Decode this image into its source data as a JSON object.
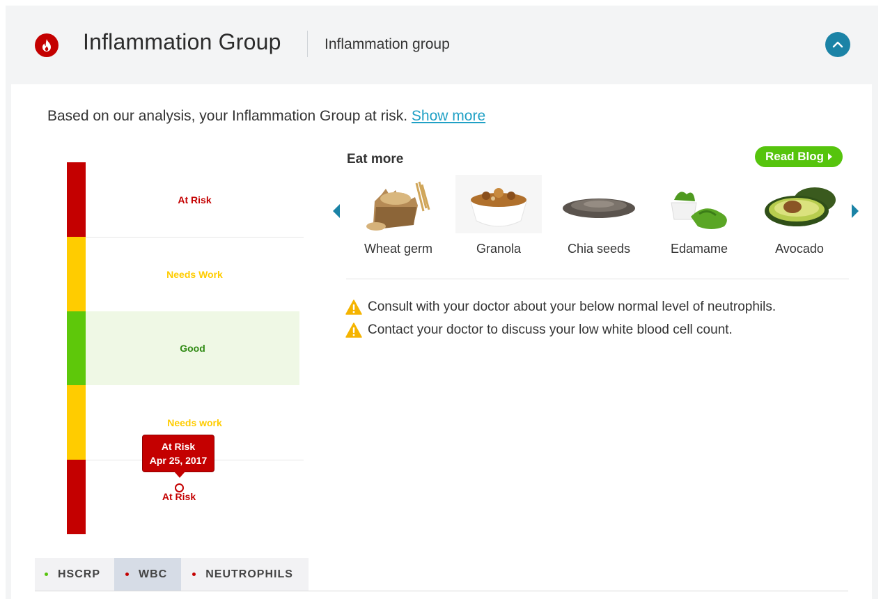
{
  "header": {
    "title": "Inflammation Group",
    "subtitle": "Inflammation group",
    "icon": "flame-icon",
    "accent": "#c40000",
    "collapse_icon": "chevron-up-icon"
  },
  "summary": {
    "text": "Based on our analysis, your Inflammation Group at risk. ",
    "link": "Show more"
  },
  "gauge": {
    "zones": [
      {
        "label": "At Risk",
        "color": "#c40000"
      },
      {
        "label": "Needs Work",
        "color": "#ffcc00"
      },
      {
        "label": "Good",
        "color": "#2f8a13"
      },
      {
        "label": "Needs work",
        "color": "#ffcc00"
      },
      {
        "label": "At Risk",
        "color": "#c40000"
      }
    ],
    "tooltip": {
      "status": "At Risk",
      "date": "Apr 25, 2017"
    },
    "current": "At Risk"
  },
  "eat_more": {
    "title": "Eat more",
    "read_blog": "Read Blog",
    "foods": [
      {
        "name": "Wheat germ",
        "icon": "wheat-germ-image"
      },
      {
        "name": "Granola",
        "icon": "granola-image"
      },
      {
        "name": "Chia seeds",
        "icon": "chia-seeds-image"
      },
      {
        "name": "Edamame",
        "icon": "edamame-image"
      },
      {
        "name": "Avocado",
        "icon": "avocado-image"
      }
    ]
  },
  "tips": [
    "Consult with your doctor about your below normal level of neutrophils.",
    "Contact your doctor to discuss your low white blood cell count."
  ],
  "tabs": [
    {
      "label": "HSCRP",
      "dot": "#56c40d",
      "active": false
    },
    {
      "label": "WBC",
      "dot": "#c40000",
      "active": true
    },
    {
      "label": "NEUTROPHILS",
      "dot": "#c40000",
      "active": false
    }
  ]
}
